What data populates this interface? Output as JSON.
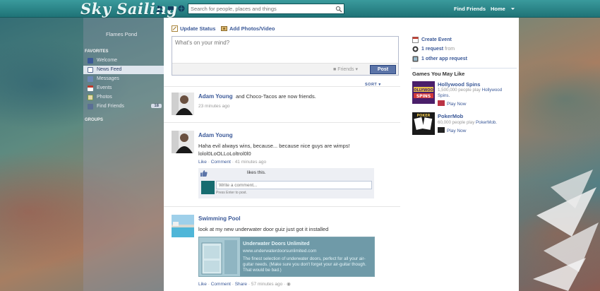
{
  "header": {
    "logo_text": "Sky Sailing",
    "search_placeholder": "Search for people, places and things",
    "nav": [
      "Find Friends",
      "Home"
    ],
    "icons": [
      "friend-requests-icon",
      "messages-icon",
      "notifications-icon",
      "search-icon",
      "account-menu-icon"
    ]
  },
  "left_nav": {
    "profile_name": "Flames Pond",
    "favorites_label": "FAVORITES",
    "items": [
      {
        "label": "Welcome",
        "icon": "welcome-icon",
        "color": "#3b5998"
      },
      {
        "label": "News Feed",
        "icon": "news-feed-icon",
        "color": "#5a6f95"
      },
      {
        "label": "Messages",
        "icon": "messages-icon",
        "color": "#6b87b5"
      },
      {
        "label": "Events",
        "icon": "events-icon",
        "color": "#c0392b"
      },
      {
        "label": "Photos",
        "icon": "photos-icon",
        "color": "#7a9a4a"
      },
      {
        "label": "Find Friends",
        "icon": "find-friends-icon",
        "color": "#5a6f95",
        "count": "18"
      }
    ],
    "groups_label": "GROUPS"
  },
  "composer": {
    "tabs": [
      {
        "label": "Update Status",
        "icon": "update-status-icon"
      },
      {
        "label": "Add Photos/Video",
        "icon": "add-photos-icon"
      }
    ],
    "placeholder": "What's on your mind?",
    "audience": "Friends",
    "post_label": "Post"
  },
  "sort_label": "SORT",
  "stories": [
    {
      "name": "Adam Young",
      "text": "and Choco-Tacos are now friends.",
      "time": "23 minutes ago"
    },
    {
      "name": "Adam Young",
      "text": "Haha evil always wins, because... because nice guys are wimps!",
      "text2": "lolol0LoOLLoLoltrol0l0",
      "actions": {
        "like": "Like",
        "comment": "Comment",
        "time": "41 minutes ago"
      },
      "likes_text": "likes this.",
      "comment_placeholder": "Write a comment...",
      "enter_hint": "Press Enter to post."
    },
    {
      "name": "Swimming Pool",
      "text": "look at my new underwater door guiz just got it installed",
      "attachment": {
        "title": "Underwater Doors Unlimited",
        "url": "www.underwaterdoorsunlimited.com",
        "description": "The finest selection of underwater doors, perfect for all your air-guitar needs. (Make sure you don't forget your air-guitar though. That would be bad.)"
      },
      "actions": {
        "like": "Like",
        "comment": "Comment",
        "share": "Share",
        "time": "57 minutes ago"
      }
    }
  ],
  "right_col": {
    "create_event": "Create Event",
    "request": "1 request",
    "request_suffix": "from",
    "app_request": "1 other app request",
    "games_title": "Games You May Like",
    "games": [
      {
        "name": "Hollywood Spins",
        "meta_prefix": "1,500,000 people play",
        "meta_link": "Hollywood Spins.",
        "play": "Play Now"
      },
      {
        "name": "PokerMob",
        "meta_prefix": "60,000 people play",
        "meta_link": "PokerMob.",
        "play": "Play Now"
      }
    ]
  },
  "colors": {
    "topbar": "#1f7377",
    "link": "#3b5998",
    "post_button": "#5b74a8",
    "attachment_bg": "#6f9aa8"
  }
}
